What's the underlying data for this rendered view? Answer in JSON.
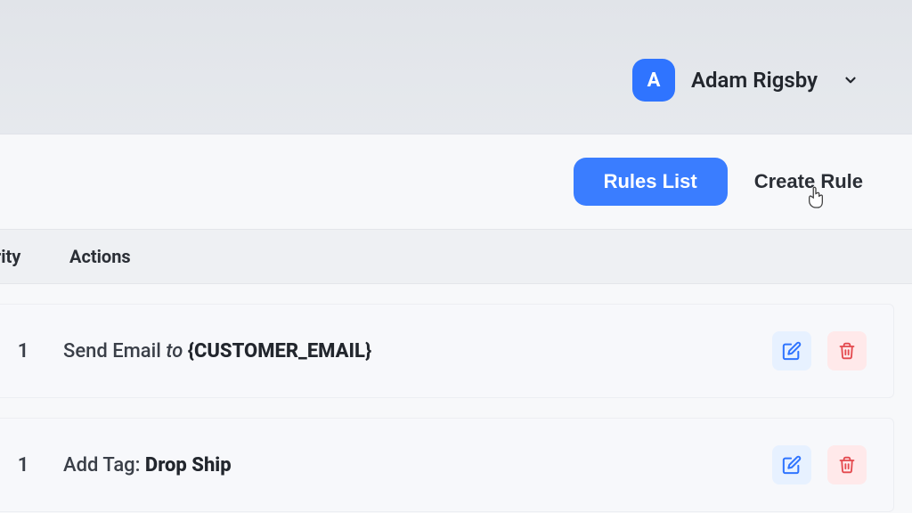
{
  "header": {
    "avatar_letter": "A",
    "user_name": "Adam Rigsby"
  },
  "toolbar": {
    "rules_list_label": "Rules List",
    "create_rule_label": "Create Rule"
  },
  "columns": {
    "priority": "riority",
    "actions": "Actions"
  },
  "rules": [
    {
      "priority": "1",
      "action_prefix": "Send Email ",
      "action_mid_italic": "to ",
      "action_bold": "{CUSTOMER_EMAIL}"
    },
    {
      "priority": "1",
      "action_prefix": "Add Tag: ",
      "action_mid_italic": "",
      "action_bold": "Drop Ship"
    }
  ]
}
